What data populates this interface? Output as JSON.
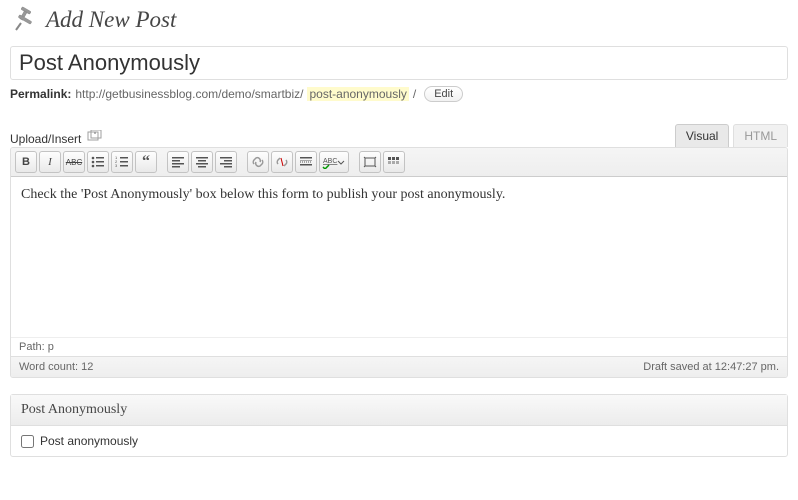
{
  "header": {
    "title": "Add New Post"
  },
  "title_input": {
    "value": "Post Anonymously"
  },
  "permalink": {
    "label": "Permalink:",
    "base": "http://getbusinessblog.com/demo/smartbiz/",
    "slug": "post-anonymously",
    "trail": "/",
    "edit_label": "Edit"
  },
  "media": {
    "label": "Upload/Insert"
  },
  "tabs": {
    "visual": "Visual",
    "html": "HTML"
  },
  "toolbar": {
    "bold": "B",
    "italic": "I",
    "strike": "ABC",
    "spellcheck": "ABC"
  },
  "editor": {
    "content": "Check the 'Post Anonymously' box below this form to publish your post anonymously.",
    "path_label": "Path:",
    "path_value": "p",
    "word_count_label": "Word count:",
    "word_count_value": "12",
    "status": "Draft saved at 12:47:27 pm."
  },
  "metabox": {
    "title": "Post Anonymously",
    "checkbox_label": "Post anonymously"
  }
}
